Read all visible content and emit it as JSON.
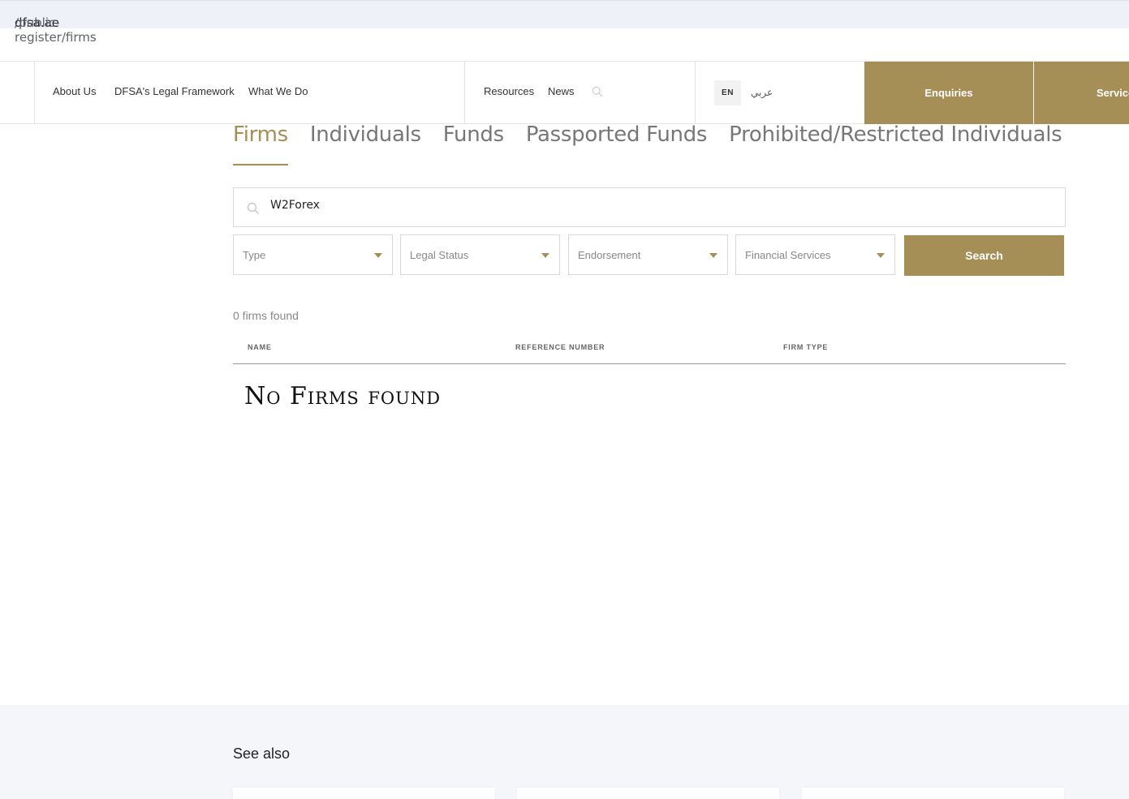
{
  "browser": {
    "url_host": "dfsa.ae",
    "url_path": "/public-register/firms"
  },
  "header": {
    "nav_left": [
      "About Us",
      "DFSA's Legal Framework",
      "What We Do"
    ],
    "nav_mid": [
      "Resources",
      "News"
    ],
    "search_icon": "search-icon",
    "lang_en": "EN",
    "lang_ar": "عربي",
    "enquiries_label": "Enquiries",
    "services_label": "Services"
  },
  "tabs": [
    {
      "label": "Firms",
      "active": true
    },
    {
      "label": "Individuals",
      "active": false
    },
    {
      "label": "Funds",
      "active": false
    },
    {
      "label": "Passported Funds",
      "active": false
    },
    {
      "label": "Prohibited/Restricted Individuals",
      "active": false
    }
  ],
  "search": {
    "value": "W2Forex",
    "icon": "search-icon"
  },
  "filters": [
    {
      "label": "Type"
    },
    {
      "label": "Legal Status"
    },
    {
      "label": "Endorsement"
    },
    {
      "label": "Financial Services"
    }
  ],
  "search_button": "Search",
  "results": {
    "count_text": "0 firms found",
    "columns": [
      "NAME",
      "REFERENCE NUMBER",
      "FIRM TYPE"
    ],
    "empty_message": "No Firms found"
  },
  "see_also": {
    "title": "See also"
  },
  "colors": {
    "accent": "#a58f57",
    "footer_bg": "#f4f6fa"
  }
}
